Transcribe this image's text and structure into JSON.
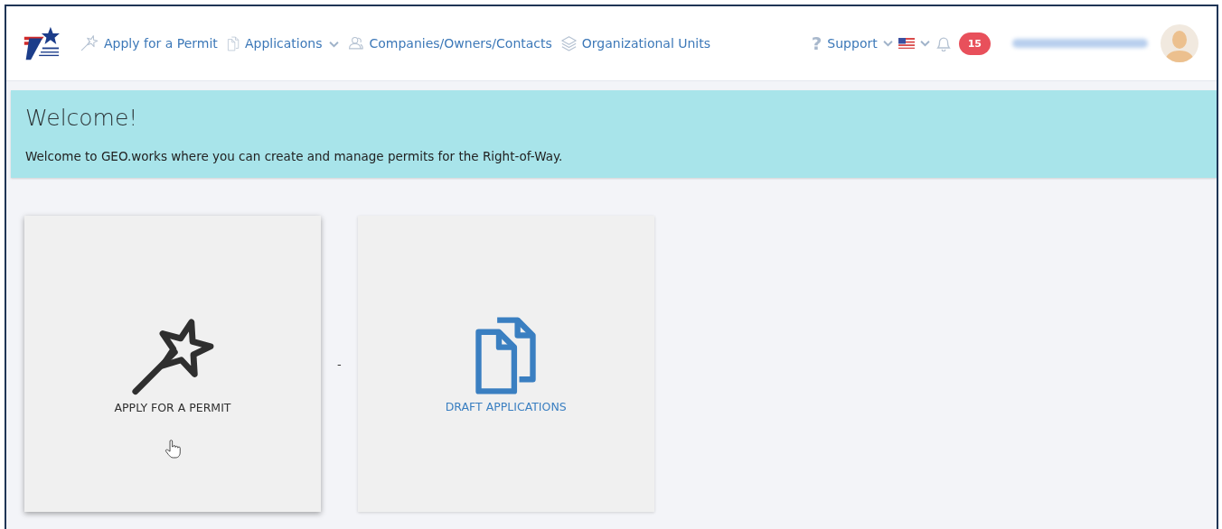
{
  "nav": {
    "items": [
      {
        "kind": "wand",
        "label": "Apply for a Permit",
        "dropdown": false
      },
      {
        "kind": "documents",
        "label": "Applications",
        "dropdown": true
      },
      {
        "kind": "people",
        "label": "Companies/Owners/Contacts",
        "dropdown": false
      },
      {
        "kind": "layers",
        "label": "Organizational Units",
        "dropdown": false
      }
    ],
    "support": {
      "label": "Support",
      "icon": "?"
    },
    "notifications": {
      "count": "15"
    }
  },
  "welcome": {
    "title": "Welcome!",
    "message": "Welcome to GEO.works where you can create and manage permits for the Right-of-Way."
  },
  "cards": [
    {
      "kind": "wand",
      "label": "APPLY FOR A PERMIT",
      "hovered": true
    },
    {
      "kind": "documents",
      "label": "DRAFT APPLICATIONS",
      "hovered": false
    }
  ],
  "separator": "-"
}
